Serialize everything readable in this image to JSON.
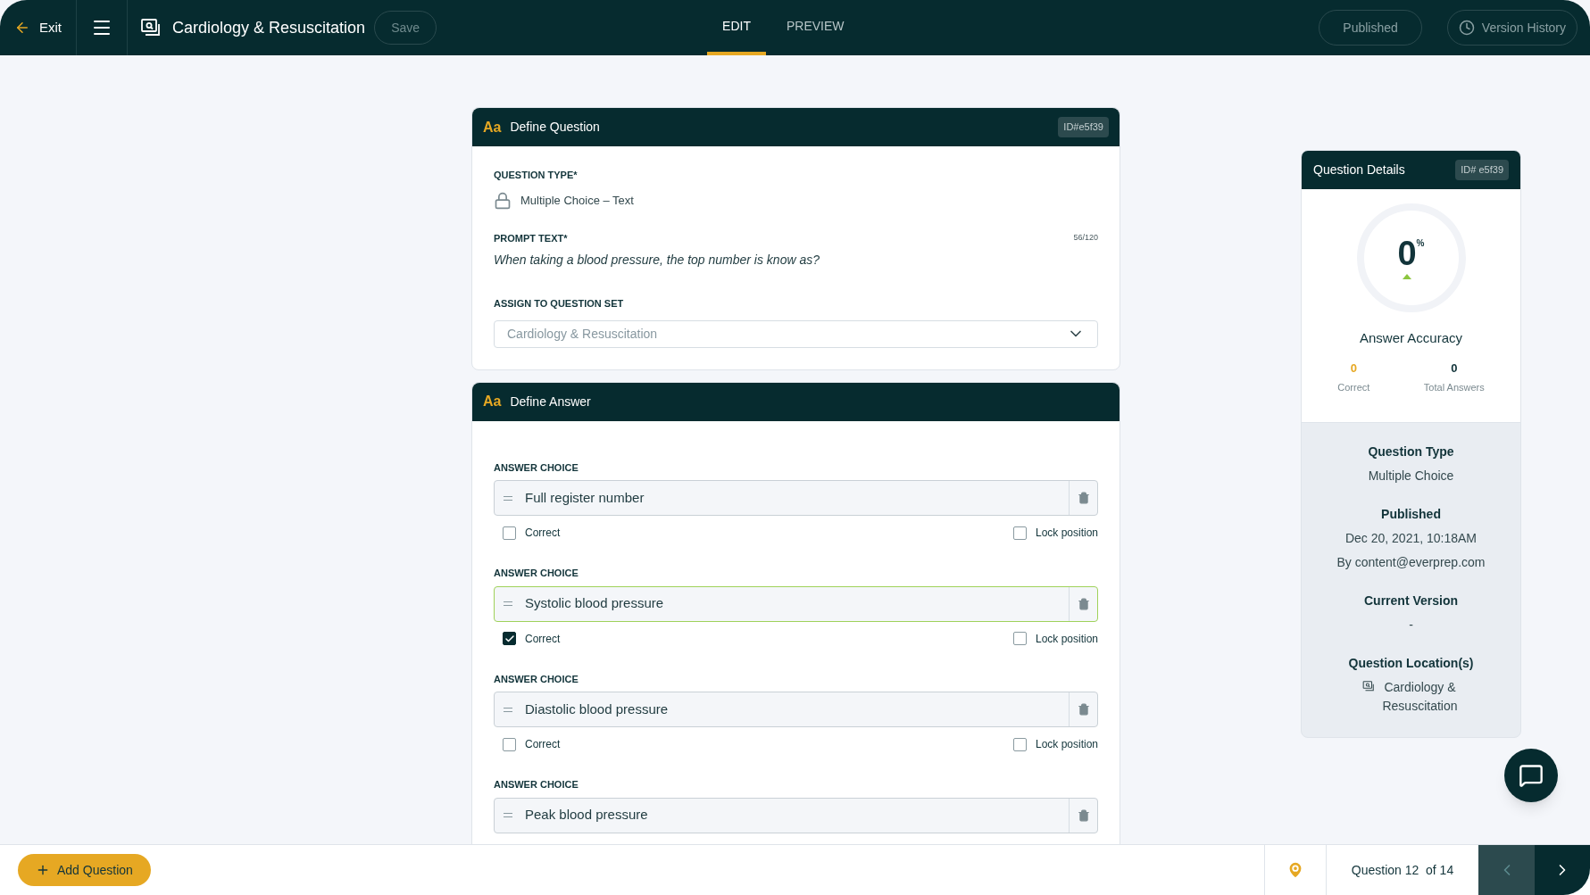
{
  "header": {
    "exit": "Exit",
    "title": "Cardiology & Resuscitation",
    "save": "Save",
    "tabs": [
      {
        "label": "EDIT",
        "selected": true
      },
      {
        "label": "PREVIEW",
        "selected": false
      }
    ],
    "published": "Published",
    "version_history": "Version History"
  },
  "question_card": {
    "icon_text": "Aa",
    "title": "Define Question",
    "id": "ID#e5f39",
    "type_label": "QUESTION TYPE*",
    "type_value": "Multiple Choice – Text",
    "prompt_label": "PROMPT TEXT*",
    "prompt_count": "56/120",
    "prompt": "When taking a blood pressure, the top number is know as?",
    "set_label": "ASSIGN TO QUESTION SET",
    "set_value": "Cardiology & Resuscitation"
  },
  "answer_card": {
    "icon_text": "Aa",
    "title": "Define Answer",
    "answers": [
      {
        "label": "ANSWER CHOICE",
        "text": "Full register number",
        "correct": false,
        "lock_position": false,
        "correct_label": "Correct",
        "lock_label": "Lock position"
      },
      {
        "label": "ANSWER CHOICE",
        "text": "Systolic blood pressure",
        "correct": true,
        "lock_position": false,
        "correct_label": "Correct",
        "lock_label": "Lock position"
      },
      {
        "label": "ANSWER CHOICE",
        "text": "Diastolic blood pressure",
        "correct": false,
        "lock_position": false,
        "correct_label": "Correct",
        "lock_label": "Lock position"
      },
      {
        "label": "ANSWER CHOICE",
        "text": "Peak blood pressure"
      }
    ]
  },
  "details": {
    "title": "Question Details",
    "id": "ID# e5f39",
    "accuracy": "0",
    "accuracy_unit": "%",
    "accuracy_label": "Answer Accuracy",
    "correct_count": "0",
    "correct_label": "Correct",
    "total_count": "0",
    "total_label": "Total Answers",
    "sections": [
      {
        "heading": "Question Type",
        "lines": [
          "Multiple Choice"
        ]
      },
      {
        "heading": "Published",
        "lines": [
          "Dec 20, 2021, 10:18AM",
          "By content@everprep.com"
        ]
      },
      {
        "heading": "Current Version",
        "lines": [
          "-"
        ]
      },
      {
        "heading": "Question Location(s)",
        "location": "Cardiology & Resuscitation"
      }
    ]
  },
  "footer": {
    "add_question": "Add Question",
    "counter": "Question 12  of 14",
    "prev_disabled": true,
    "next_disabled": false
  }
}
